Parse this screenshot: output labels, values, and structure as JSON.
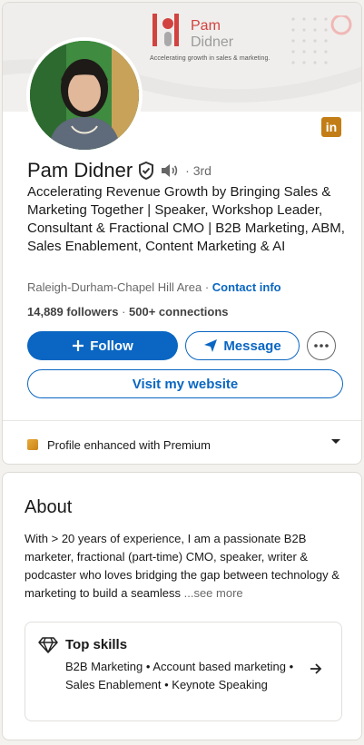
{
  "banner": {
    "brand_first": "Pam",
    "brand_second": "Didner",
    "tagline": "Accelerating growth in sales & marketing."
  },
  "profile": {
    "name": "Pam Didner",
    "degree": "· 3rd",
    "headline": "Accelerating Revenue Growth by Bringing Sales & Marketing Together | Speaker, Workshop Leader, Consultant & Fractional CMO | B2B Marketing, ABM, Sales Enablement, Content Marketing & AI",
    "location": "Raleigh-Durham-Chapel Hill Area",
    "separator": "·",
    "contact_info": "Contact info",
    "followers": "14,889 followers",
    "connections": "500+ connections",
    "linkedin_badge": "in"
  },
  "actions": {
    "follow": "Follow",
    "message": "Message",
    "website": "Visit my website"
  },
  "premium": {
    "label": "Profile enhanced with Premium"
  },
  "about": {
    "title": "About",
    "text": "With > 20 years of experience, I am a passionate B2B marketer, fractional (part-time) CMO, speaker, writer & podcaster who loves bridging the gap between technology & marketing to build a seamless",
    "see_more": "...see more",
    "skills_title": "Top skills",
    "skills_list": "B2B Marketing • Account based marketing • Sales Enablement • Keynote Speaking"
  },
  "colors": {
    "accent": "#0a66c2",
    "brand_red": "#d2433f",
    "premium_gold": "#c37d16"
  },
  "icons": [
    "verified-shield-icon",
    "speaker-icon",
    "plus-icon",
    "send-icon",
    "more-icon",
    "premium-icon",
    "caret-down-icon",
    "gem-icon",
    "arrow-right-icon",
    "linkedin-icon"
  ]
}
